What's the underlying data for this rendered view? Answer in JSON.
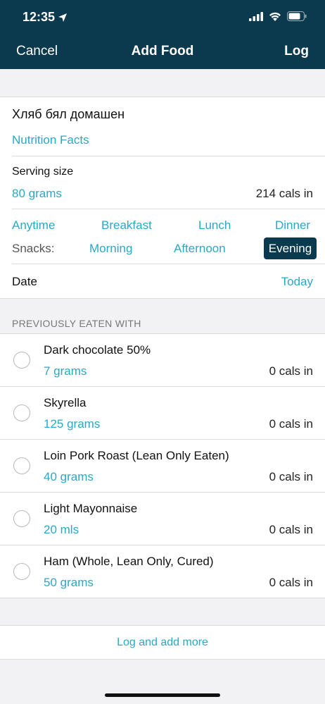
{
  "status_bar": {
    "time": "12:35"
  },
  "nav": {
    "cancel": "Cancel",
    "title": "Add Food",
    "log": "Log"
  },
  "food": {
    "name": "Хляб бял домашен",
    "nutrition_facts_link": "Nutrition Facts",
    "serving_label": "Serving size",
    "serving_value": "80 grams",
    "calories": "214 cals in"
  },
  "meals": {
    "anytime": "Anytime",
    "breakfast": "Breakfast",
    "lunch": "Lunch",
    "dinner": "Dinner",
    "snacks_label": "Snacks:",
    "morning": "Morning",
    "afternoon": "Afternoon",
    "evening": "Evening",
    "selected": "Evening"
  },
  "date": {
    "label": "Date",
    "value": "Today"
  },
  "previously": {
    "header": "PREVIOUSLY EATEN WITH",
    "items": [
      {
        "name": "Dark chocolate 50%",
        "qty": "7 grams",
        "cals": "0 cals in"
      },
      {
        "name": "Skyrella",
        "qty": "125 grams",
        "cals": "0 cals in"
      },
      {
        "name": "Loin Pork Roast (Lean Only Eaten)",
        "qty": "40 grams",
        "cals": "0 cals in"
      },
      {
        "name": "Light Mayonnaise",
        "qty": "20 mls",
        "cals": "0 cals in"
      },
      {
        "name": "Ham (Whole, Lean Only, Cured)",
        "qty": "50 grams",
        "cals": "0 cals in"
      }
    ]
  },
  "footer": {
    "log_and_add_more": "Log and add more"
  },
  "colors": {
    "header_bg": "#0b3a4e",
    "accent": "#2aa8c6"
  }
}
